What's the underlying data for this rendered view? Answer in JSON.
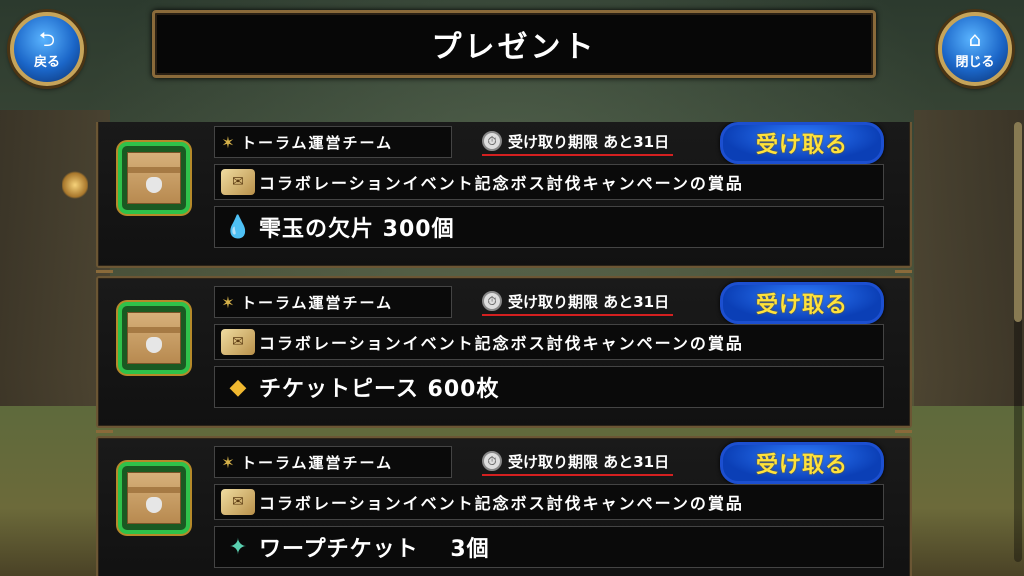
{
  "header": {
    "title": "プレゼント",
    "back_label": "戻る",
    "close_label": "閉じる"
  },
  "presents": [
    {
      "sender": "トーラム運営チーム",
      "deadline": "受け取り期限 あと31日",
      "receive_label": "受け取る",
      "reason": "コラボレーションイベント記念ボス討伐キャンペーンの賞品",
      "reward": "雫玉の欠片 300個",
      "reward_icon": "water-drops-icon"
    },
    {
      "sender": "トーラム運営チーム",
      "deadline": "受け取り期限 あと31日",
      "receive_label": "受け取る",
      "reason": "コラボレーションイベント記念ボス討伐キャンペーンの賞品",
      "reward": "チケットピース 600枚",
      "reward_icon": "ticket-pieces-icon"
    },
    {
      "sender": "トーラム運営チーム",
      "deadline": "受け取り期限 あと31日",
      "receive_label": "受け取る",
      "reason": "コラボレーションイベント記念ボス討伐キャンペーンの賞品",
      "reward": "ワープチケット 　3個",
      "reward_icon": "warp-ticket-icon"
    }
  ],
  "colors": {
    "accent_gold": "#8a6a3a",
    "button_blue": "#0b3fb6",
    "button_text": "#ffe23a",
    "deadline_underline": "#d42020",
    "item_frame_green": "#2fc24a"
  }
}
